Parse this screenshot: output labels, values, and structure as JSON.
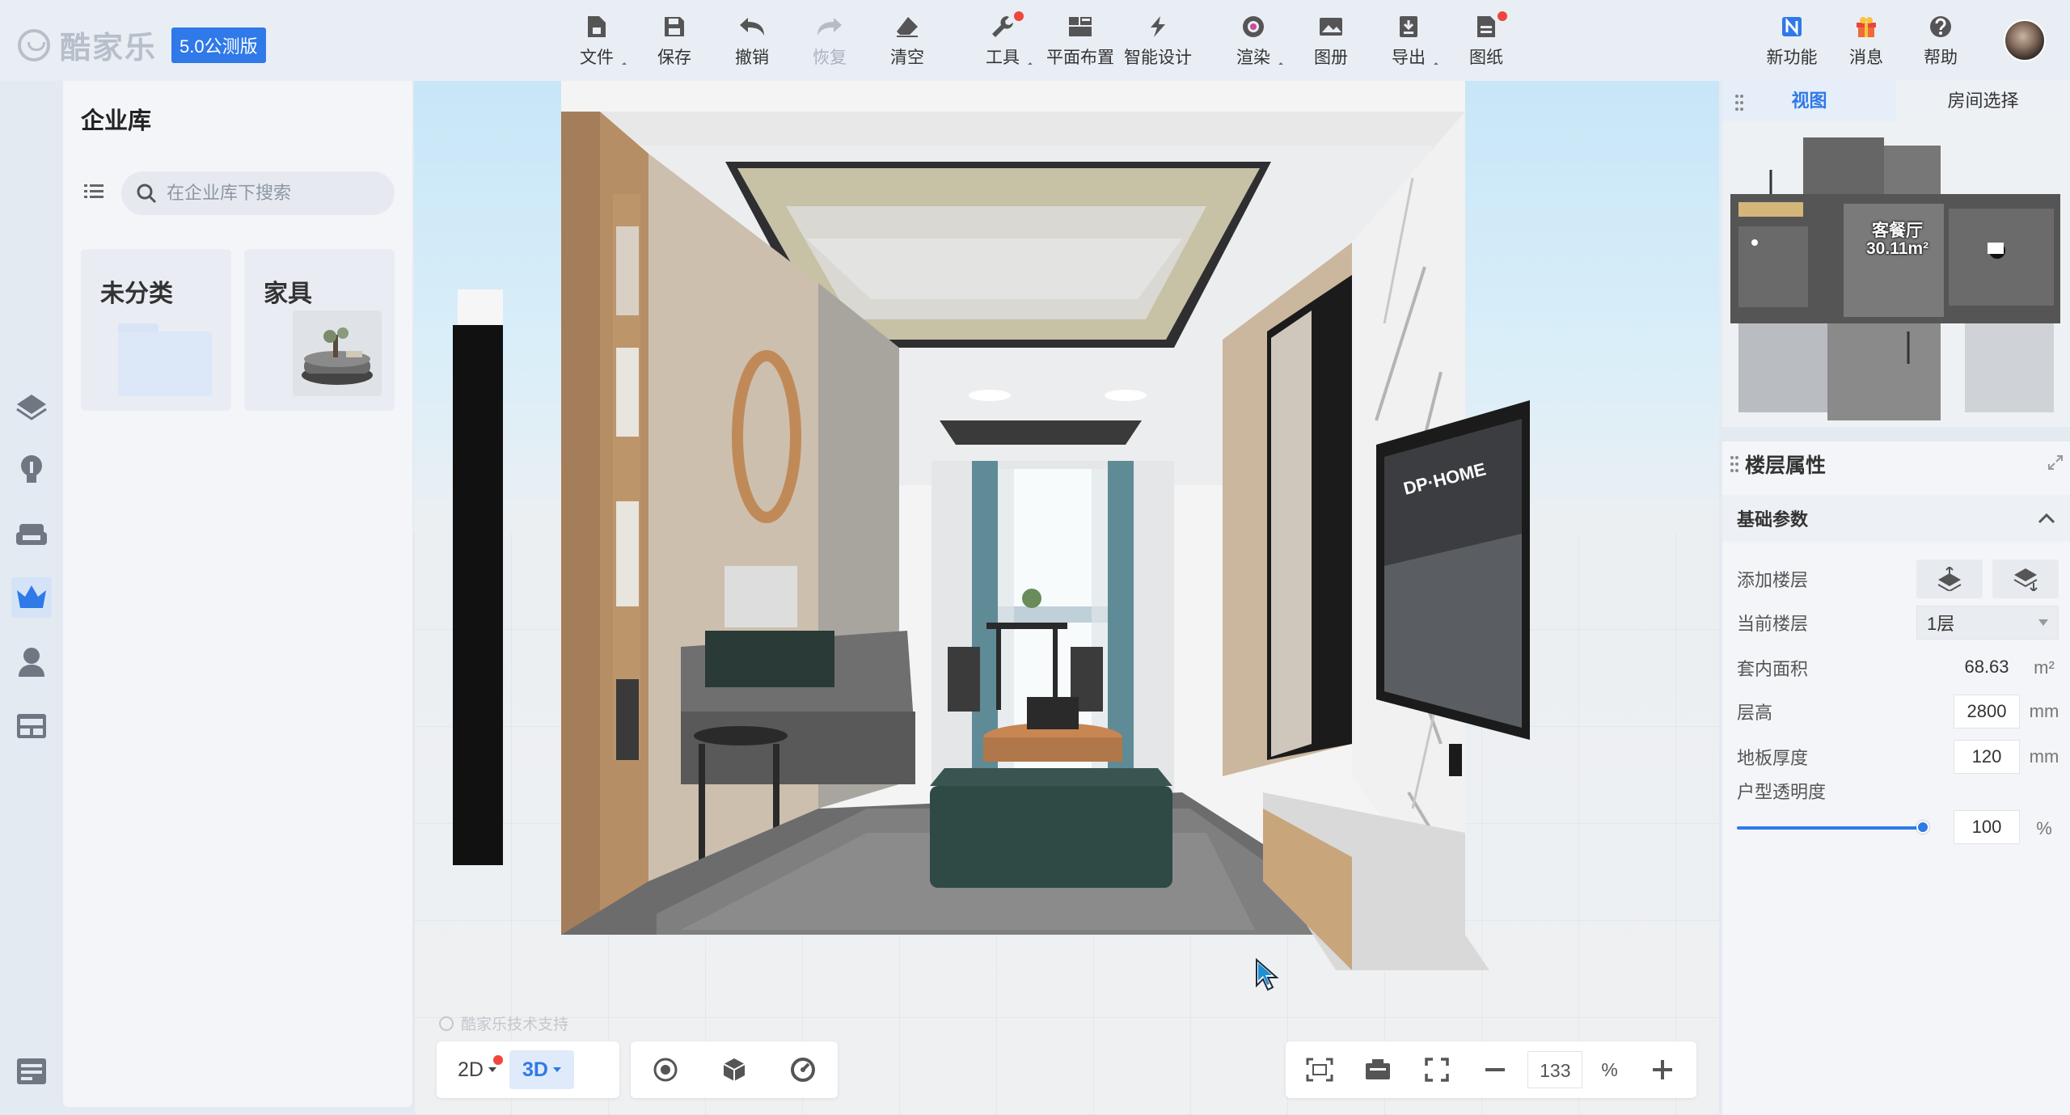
{
  "app": {
    "logo_text": "酷家乐",
    "version": "5.0公测版"
  },
  "toolbar": {
    "items": [
      {
        "icon": "file-icon",
        "label": "文件"
      },
      {
        "icon": "save-icon",
        "label": "保存"
      },
      {
        "icon": "undo-icon",
        "label": "撤销"
      },
      {
        "icon": "redo-icon",
        "label": "恢复",
        "disabled": true
      },
      {
        "icon": "eraser-icon",
        "label": "清空"
      },
      {
        "icon": "wrench-icon",
        "label": "工具"
      },
      {
        "icon": "floor-plan-icon",
        "label": "平面布置"
      },
      {
        "icon": "lightning-icon",
        "label": "智能设计"
      },
      {
        "icon": "render-camera-icon",
        "label": "渲染"
      },
      {
        "icon": "album-icon",
        "label": "图册"
      },
      {
        "icon": "export-icon",
        "label": "导出"
      },
      {
        "icon": "drawing-icon",
        "label": "图纸"
      }
    ],
    "right": [
      {
        "icon": "new-feature-icon",
        "label": "新功能"
      },
      {
        "icon": "gift-icon",
        "label": "消息"
      },
      {
        "icon": "help-icon",
        "label": "帮助"
      }
    ]
  },
  "library": {
    "title": "企业库",
    "search_placeholder": "在企业库下搜索",
    "categories": [
      {
        "label": "未分类"
      },
      {
        "label": "家具"
      }
    ]
  },
  "viewport": {
    "watermark": "酷家乐技术支持",
    "modes": {
      "two_d": "2D",
      "three_d": "3D"
    },
    "zoom": "133",
    "zoom_unit": "%",
    "tv_brand": "DP·HOME"
  },
  "minimap": {
    "tabs": [
      "视图",
      "房间选择"
    ],
    "room_name": "客餐厅",
    "room_area": "30.11m²"
  },
  "props": {
    "title": "楼层属性",
    "section": "基础参数",
    "add_floor_label": "添加楼层",
    "current_floor_label": "当前楼层",
    "current_floor_value": "1层",
    "inner_area_label": "套内面积",
    "inner_area_value": "68.63",
    "inner_area_unit": "m²",
    "floor_height_label": "层高",
    "floor_height_value": "2800",
    "floor_height_unit": "mm",
    "slab_label": "地板厚度",
    "slab_value": "120",
    "slab_unit": "mm",
    "transparency_label": "户型透明度",
    "transparency_value": "100",
    "transparency_unit": "%",
    "transparency_fraction": 1.0
  },
  "colors": {
    "accent": "#2f79e8",
    "notify": "#f0463b",
    "tv_brand": "#ffffff"
  }
}
